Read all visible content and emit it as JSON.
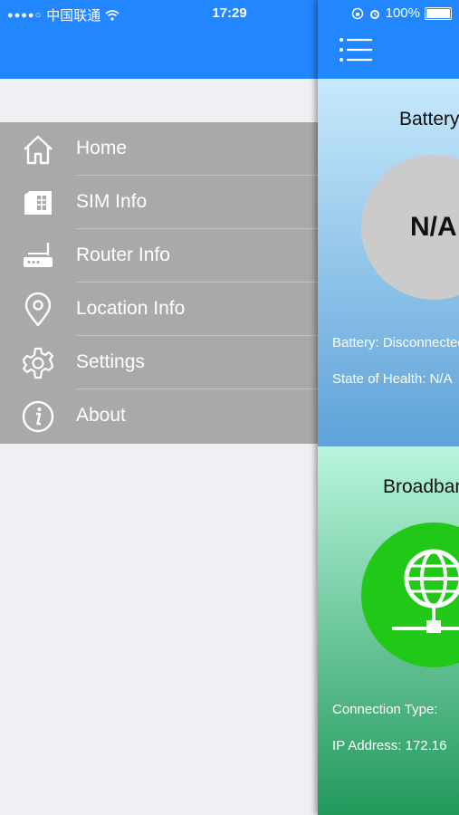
{
  "status_bar": {
    "signal": "●●●●○",
    "carrier": "中国联通",
    "time": "17:29",
    "battery": "100%"
  },
  "menu": {
    "items": [
      {
        "label": "Home",
        "icon": "home-icon"
      },
      {
        "label": "SIM Info",
        "icon": "sim-card-icon"
      },
      {
        "label": "Router Info",
        "icon": "router-icon"
      },
      {
        "label": "Location Info",
        "icon": "location-pin-icon"
      },
      {
        "label": "Settings",
        "icon": "gear-icon"
      },
      {
        "label": "About",
        "icon": "info-icon"
      }
    ]
  },
  "battery_card": {
    "title": "Battery",
    "status_value": "N/A",
    "battery_line": "Battery: Disconnected",
    "health_line": "State of Health: N/A"
  },
  "broadband_card": {
    "title": "Broadband",
    "icon": "globe-network-icon",
    "connection_line": "Connection Type: ",
    "ip_line": "IP Address: 172.16"
  },
  "colors": {
    "accent": "#2286fe",
    "menu_bg": "#a9a9a9",
    "battery_circle": "#cbcbcb",
    "broadband_circle": "#22c818"
  }
}
